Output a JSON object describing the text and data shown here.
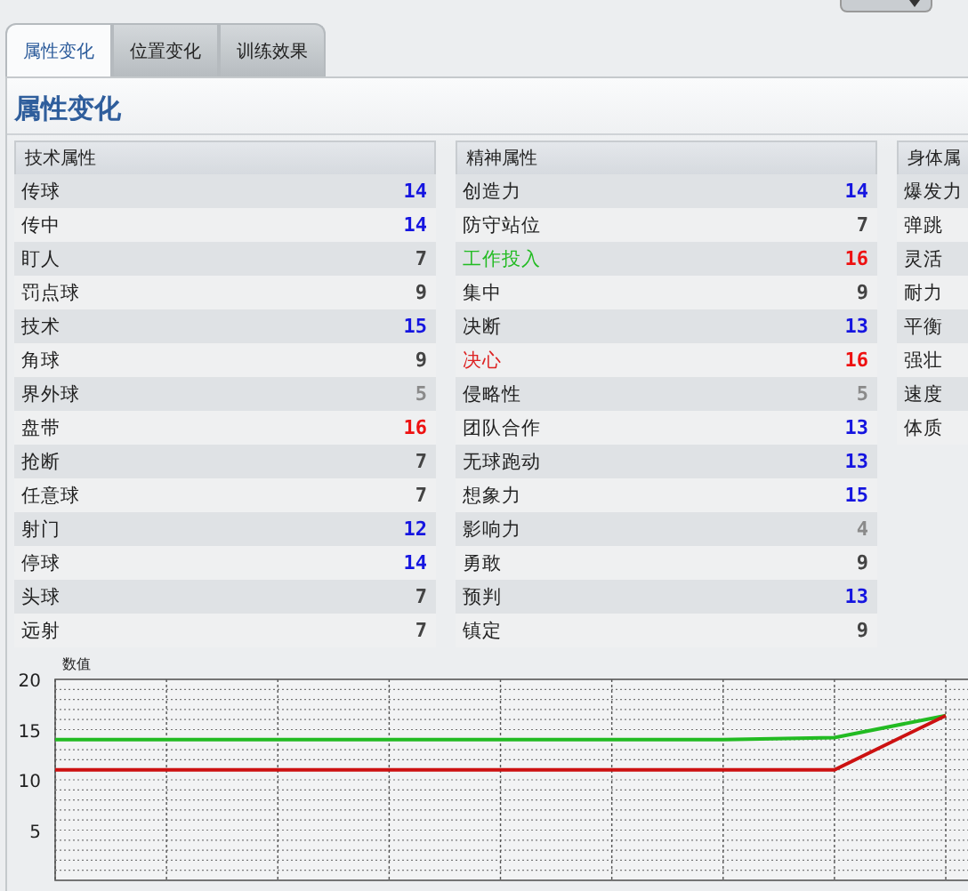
{
  "tabs": [
    {
      "label": "属性变化",
      "selected": true
    },
    {
      "label": "位置变化",
      "selected": false
    },
    {
      "label": "训练效果",
      "selected": false
    }
  ],
  "title": "属性变化",
  "groups": [
    {
      "header": "技术属性",
      "rows": [
        {
          "label": "传球",
          "value": "14",
          "color": "#1515e0"
        },
        {
          "label": "传中",
          "value": "14",
          "color": "#1515e0"
        },
        {
          "label": "盯人",
          "value": "7",
          "color": "#444444"
        },
        {
          "label": "罚点球",
          "value": "9",
          "color": "#444444"
        },
        {
          "label": "技术",
          "value": "15",
          "color": "#1515e0"
        },
        {
          "label": "角球",
          "value": "9",
          "color": "#444444"
        },
        {
          "label": "界外球",
          "value": "5",
          "color": "#8a8a8a"
        },
        {
          "label": "盘带",
          "value": "16",
          "color": "#ee1111"
        },
        {
          "label": "抢断",
          "value": "7",
          "color": "#444444"
        },
        {
          "label": "任意球",
          "value": "7",
          "color": "#444444"
        },
        {
          "label": "射门",
          "value": "12",
          "color": "#1515e0"
        },
        {
          "label": "停球",
          "value": "14",
          "color": "#1515e0"
        },
        {
          "label": "头球",
          "value": "7",
          "color": "#444444"
        },
        {
          "label": "远射",
          "value": "7",
          "color": "#444444"
        }
      ]
    },
    {
      "header": "精神属性",
      "rows": [
        {
          "label": "创造力",
          "value": "14",
          "color": "#1515e0"
        },
        {
          "label": "防守站位",
          "value": "7",
          "color": "#444444"
        },
        {
          "label": "工作投入",
          "value": "16",
          "color": "#ee1111",
          "tint": {
            "color": "#22bb22"
          }
        },
        {
          "label": "集中",
          "value": "9",
          "color": "#444444"
        },
        {
          "label": "决断",
          "value": "13",
          "color": "#1515e0"
        },
        {
          "label": "决心",
          "value": "16",
          "color": "#ee1111",
          "tint": {
            "color": "#dd2222"
          }
        },
        {
          "label": "侵略性",
          "value": "5",
          "color": "#8a8a8a"
        },
        {
          "label": "团队合作",
          "value": "13",
          "color": "#1515e0"
        },
        {
          "label": "无球跑动",
          "value": "13",
          "color": "#1515e0"
        },
        {
          "label": "想象力",
          "value": "15",
          "color": "#1515e0"
        },
        {
          "label": "影响力",
          "value": "4",
          "color": "#8a8a8a"
        },
        {
          "label": "勇敢",
          "value": "9",
          "color": "#444444"
        },
        {
          "label": "预判",
          "value": "13",
          "color": "#1515e0"
        },
        {
          "label": "镇定",
          "value": "9",
          "color": "#444444"
        }
      ]
    },
    {
      "header": "身体属",
      "rows": [
        {
          "label": "爆发力"
        },
        {
          "label": "弹跳"
        },
        {
          "label": "灵活"
        },
        {
          "label": "耐力"
        },
        {
          "label": "平衡"
        },
        {
          "label": "强壮"
        },
        {
          "label": "速度"
        },
        {
          "label": "体质"
        }
      ]
    }
  ],
  "chart_data": {
    "type": "line",
    "grid": true,
    "ylabel": "数值",
    "ylim": [
      0,
      20
    ],
    "yticks": [
      5,
      10,
      15,
      20
    ],
    "series": [
      {
        "color": "#22bb22",
        "values": [
          14,
          14,
          14,
          14,
          14,
          14,
          14,
          14.2,
          16.4
        ]
      },
      {
        "color": "#cc1111",
        "values": [
          11,
          11,
          11,
          11,
          11,
          11,
          11,
          11,
          16.4
        ]
      }
    ]
  }
}
